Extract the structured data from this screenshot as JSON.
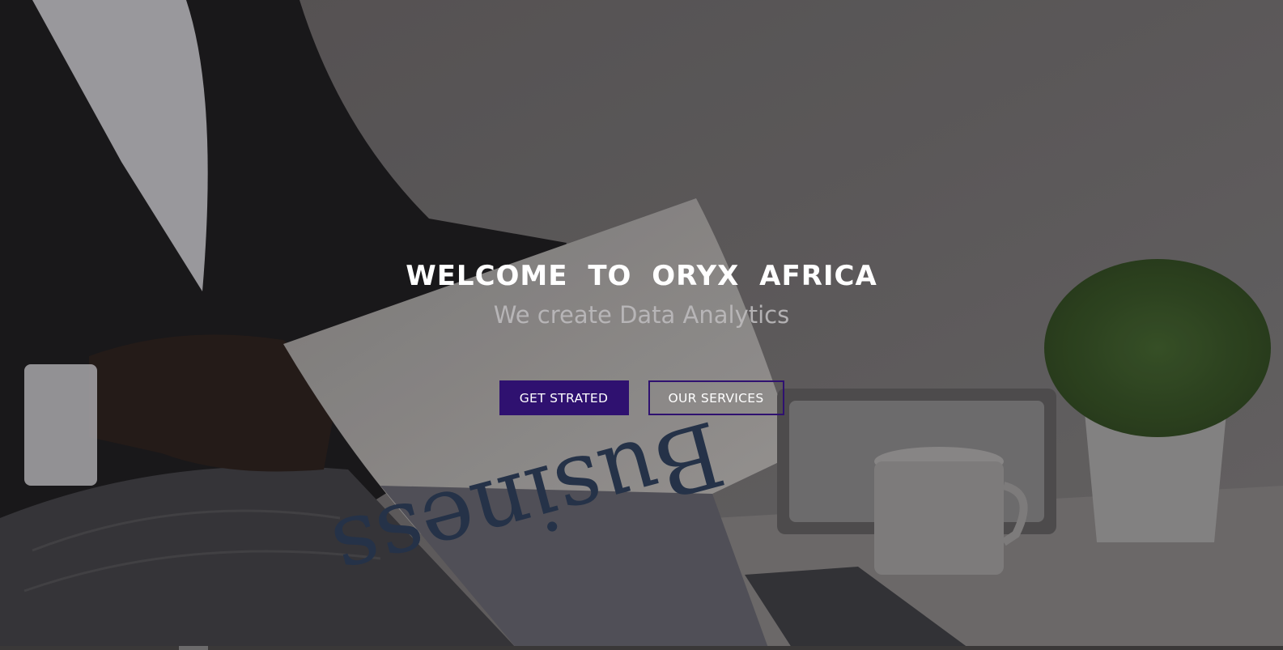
{
  "hero": {
    "title": "WELCOME TO ORYX AFRICA",
    "subtitle": "We create Data Analytics",
    "buttons": {
      "primary_label": "GET STRATED",
      "secondary_label": "OUR SERVICES"
    },
    "newspaper_headline": "Business"
  },
  "colors": {
    "accent": "#2f1170",
    "title": "#ffffff",
    "subtitle": "#bdbbbd"
  }
}
